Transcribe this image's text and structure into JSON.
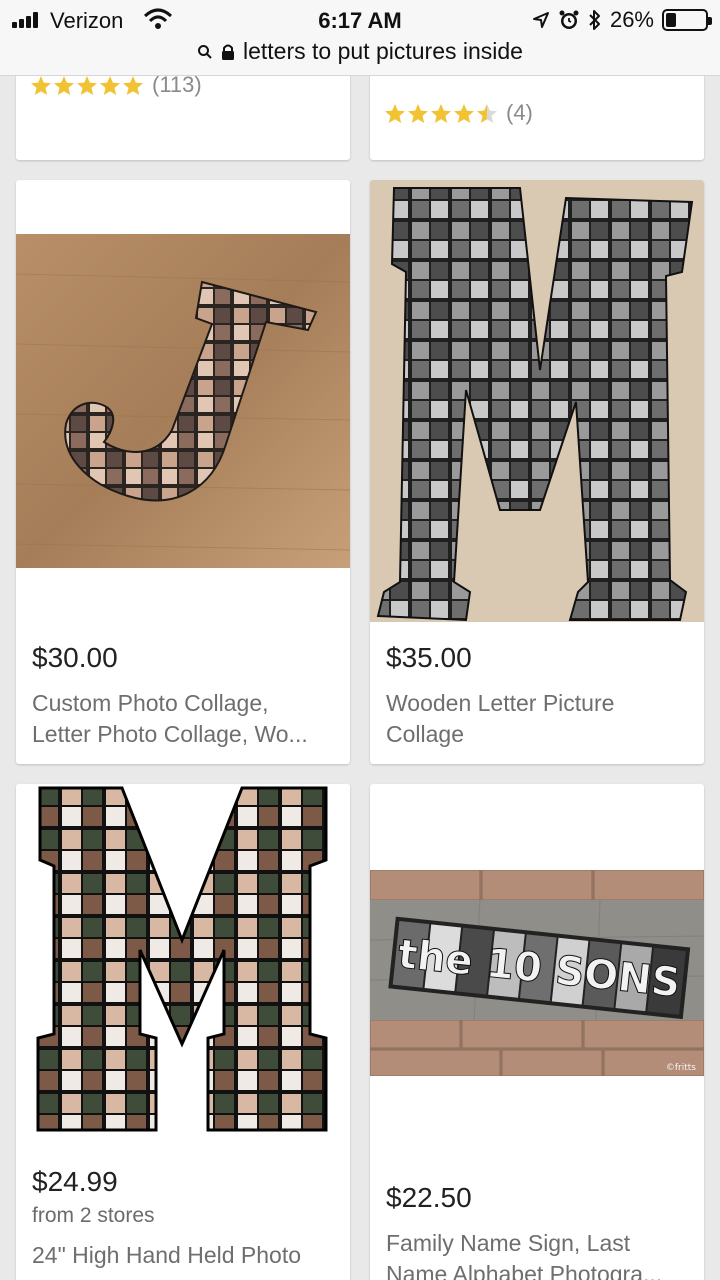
{
  "status_bar": {
    "carrier": "Verizon",
    "time": "6:17 AM",
    "battery": "26%",
    "battery_level": 0.26
  },
  "url_bar": {
    "query": "letters to put pictures inside"
  },
  "colors": {
    "star": "#f1c232",
    "star_empty": "#d9d9d9",
    "price": "#222222",
    "title": "#6e6e6e"
  },
  "partial_cards": [
    {
      "rating": 5.0,
      "review_count": "(113)"
    },
    {
      "rating": 4.5,
      "review_count": "(4)"
    }
  ],
  "products": [
    {
      "image": "letter-j-photo-collage",
      "price": "$30.00",
      "title_line1": "Custom Photo Collage,",
      "title_line2": "Letter Photo Collage, Wo..."
    },
    {
      "image": "letter-m-wooden-collage",
      "price": "$35.00",
      "title_line1": "Wooden Letter Picture",
      "title_line2": "Collage"
    },
    {
      "image": "letter-m-wedding-collage",
      "price": "$24.99",
      "subtitle": "from 2 stores",
      "title_line1": "24\" High Hand Held Photo"
    },
    {
      "image": "family-name-sign-alphabet-photos",
      "sign_text": "the 10 SONS",
      "watermark": "©fritts",
      "price": "$22.50",
      "title_line1": "Family Name Sign, Last",
      "title_line2": "Name Alphabet Photogra..."
    }
  ]
}
